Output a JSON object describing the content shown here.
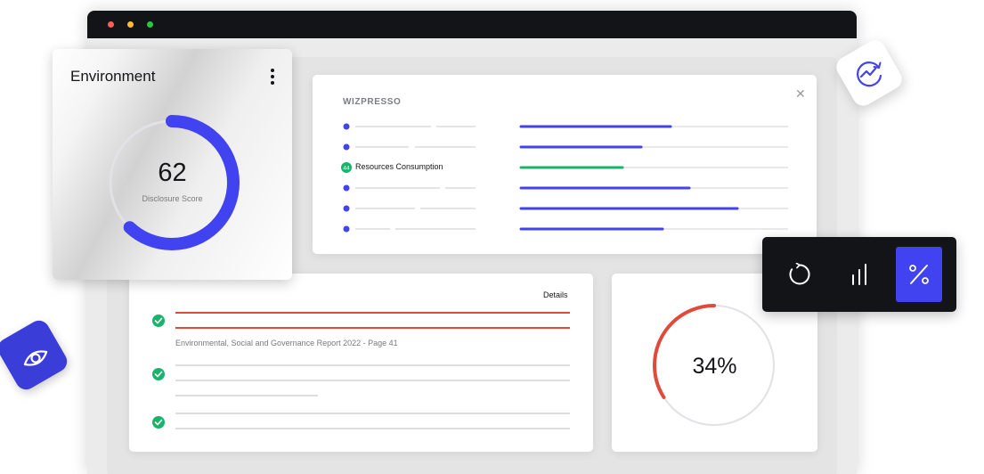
{
  "colors": {
    "accent": "#4142f0",
    "accent_tile": "#3b3dd9",
    "success": "#19b36b",
    "danger": "#e04a3b",
    "dark": "#131418",
    "track": "#e2e2e6"
  },
  "window_controls": [
    {
      "name": "close",
      "color": "#ff5f57"
    },
    {
      "name": "minimize",
      "color": "#febc2e"
    },
    {
      "name": "zoom",
      "color": "#28c840"
    }
  ],
  "environment_card": {
    "title": "Environment",
    "menu_icon": "more-vertical-icon",
    "score_value": "62",
    "score_label": "Disclosure Score",
    "score_fraction": 0.62
  },
  "wizpresso_panel": {
    "logo": "WIZPRESSO",
    "close_icon": "close-icon",
    "rows": [
      {
        "marker": "dot",
        "label": "",
        "bar_fraction": 0.56,
        "color": "#4142f0"
      },
      {
        "marker": "dot",
        "label": "",
        "bar_fraction": 0.45,
        "color": "#4142f0"
      },
      {
        "marker": "badge",
        "badge_text": "44",
        "label": "Resources Consumption",
        "bar_fraction": 0.38,
        "color": "#19b36b"
      },
      {
        "marker": "dot",
        "label": "",
        "bar_fraction": 0.63,
        "color": "#4142f0"
      },
      {
        "marker": "dot",
        "label": "",
        "bar_fraction": 0.81,
        "color": "#4142f0"
      },
      {
        "marker": "dot",
        "label": "",
        "bar_fraction": 0.53,
        "color": "#4142f0"
      }
    ]
  },
  "details_card": {
    "details_link": "Details",
    "report_title": "Environmental, Social and Governance Report 2022 - Page 41",
    "check_icon": "check-circle-icon"
  },
  "percent_card": {
    "value": "34%",
    "fraction": 0.34
  },
  "toolbar": {
    "buttons": [
      {
        "icon": "refresh-circle-icon",
        "active": false
      },
      {
        "icon": "bar-chart-icon",
        "active": false
      },
      {
        "icon": "percent-icon",
        "active": true
      }
    ]
  },
  "floating_tiles": {
    "top_right_icon": "chart-refresh-icon",
    "bottom_left_icon": "eye-icon"
  }
}
